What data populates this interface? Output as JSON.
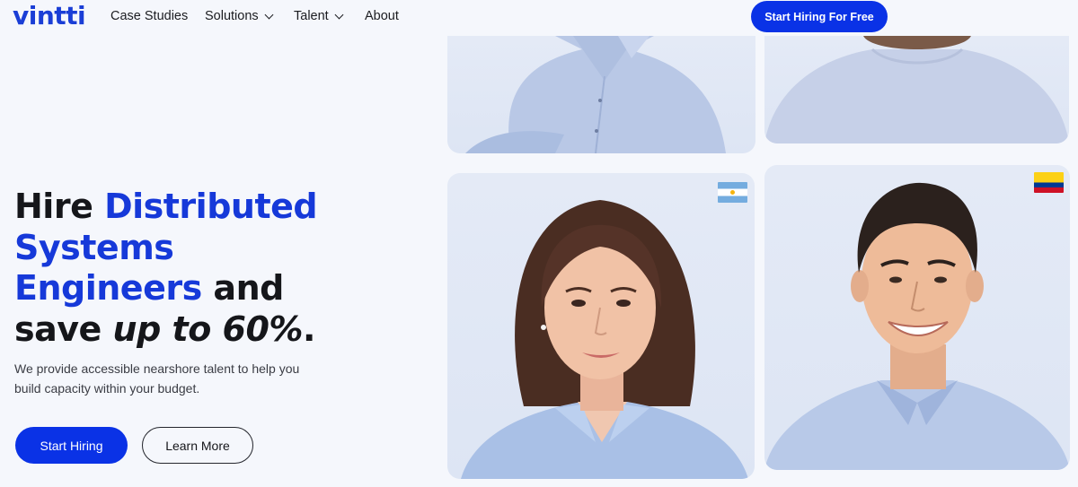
{
  "brand": {
    "logo": "vintti"
  },
  "nav": {
    "links": [
      {
        "label": "Case Studies",
        "has_dropdown": false
      },
      {
        "label": "Solutions",
        "has_dropdown": true
      },
      {
        "label": "Talent",
        "has_dropdown": true
      },
      {
        "label": "About",
        "has_dropdown": false
      }
    ],
    "cta": "Start Hiring For Free"
  },
  "hero": {
    "title_parts": {
      "hire": "Hire ",
      "role_line1": "Distributed",
      "role_line2": "Systems",
      "role_line3": "Engineers",
      "and": " and",
      "save": "save ",
      "savings": "up to 60%",
      "period": "."
    },
    "subtitle": "We provide accessible nearshore talent to help you build capacity within your budget.",
    "primary_button": "Start Hiring",
    "secondary_button": "Learn More"
  },
  "talent_cards": [
    {
      "name": "talent-photo-man-shirt-top"
    },
    {
      "name": "talent-photo-sweater-top"
    },
    {
      "name": "talent-photo-woman",
      "flag": "argentina-flag"
    },
    {
      "name": "talent-photo-man",
      "flag": "colombia-flag"
    }
  ],
  "colors": {
    "brand_blue": "#0a32e6",
    "headline_highlight": "#1639d9",
    "background": "#f5f7fc"
  }
}
